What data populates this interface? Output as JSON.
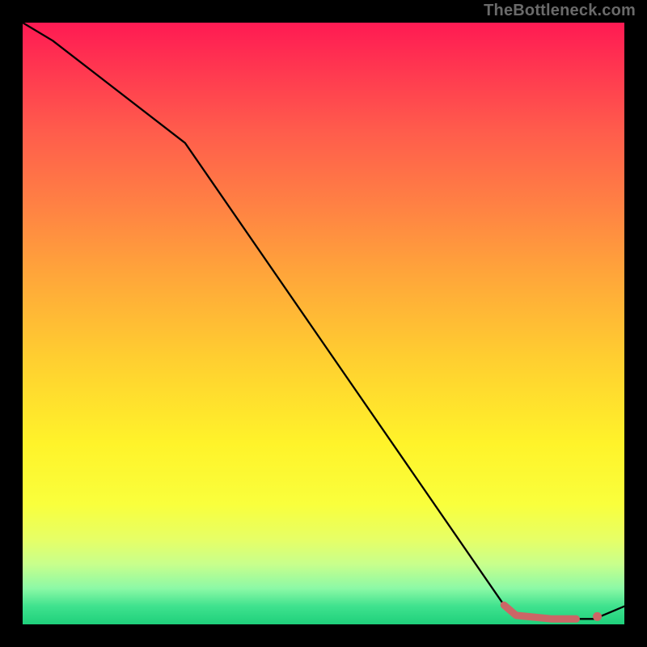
{
  "attribution": "TheBottleneck.com",
  "colors": {
    "line": "#000000",
    "fit": "#cc6666",
    "gradient_top": "#ff1a53",
    "gradient_bottom": "#1fd07b",
    "frame": "#000000"
  },
  "chart_data": {
    "type": "line",
    "title": "",
    "xlabel": "",
    "ylabel": "",
    "xlim": [
      0,
      100
    ],
    "ylim": [
      0,
      100
    ],
    "x": [
      0,
      5,
      27,
      80,
      82,
      88,
      92,
      95,
      100
    ],
    "values": [
      100,
      97,
      80,
      3.2,
      1.5,
      0.9,
      0.9,
      0.9,
      3.0
    ],
    "fit_segment": {
      "x": [
        80,
        82,
        88,
        92
      ],
      "y": [
        3.2,
        1.5,
        0.9,
        0.9
      ]
    },
    "fit_point": {
      "x": 95.5,
      "y": 1.3
    }
  }
}
